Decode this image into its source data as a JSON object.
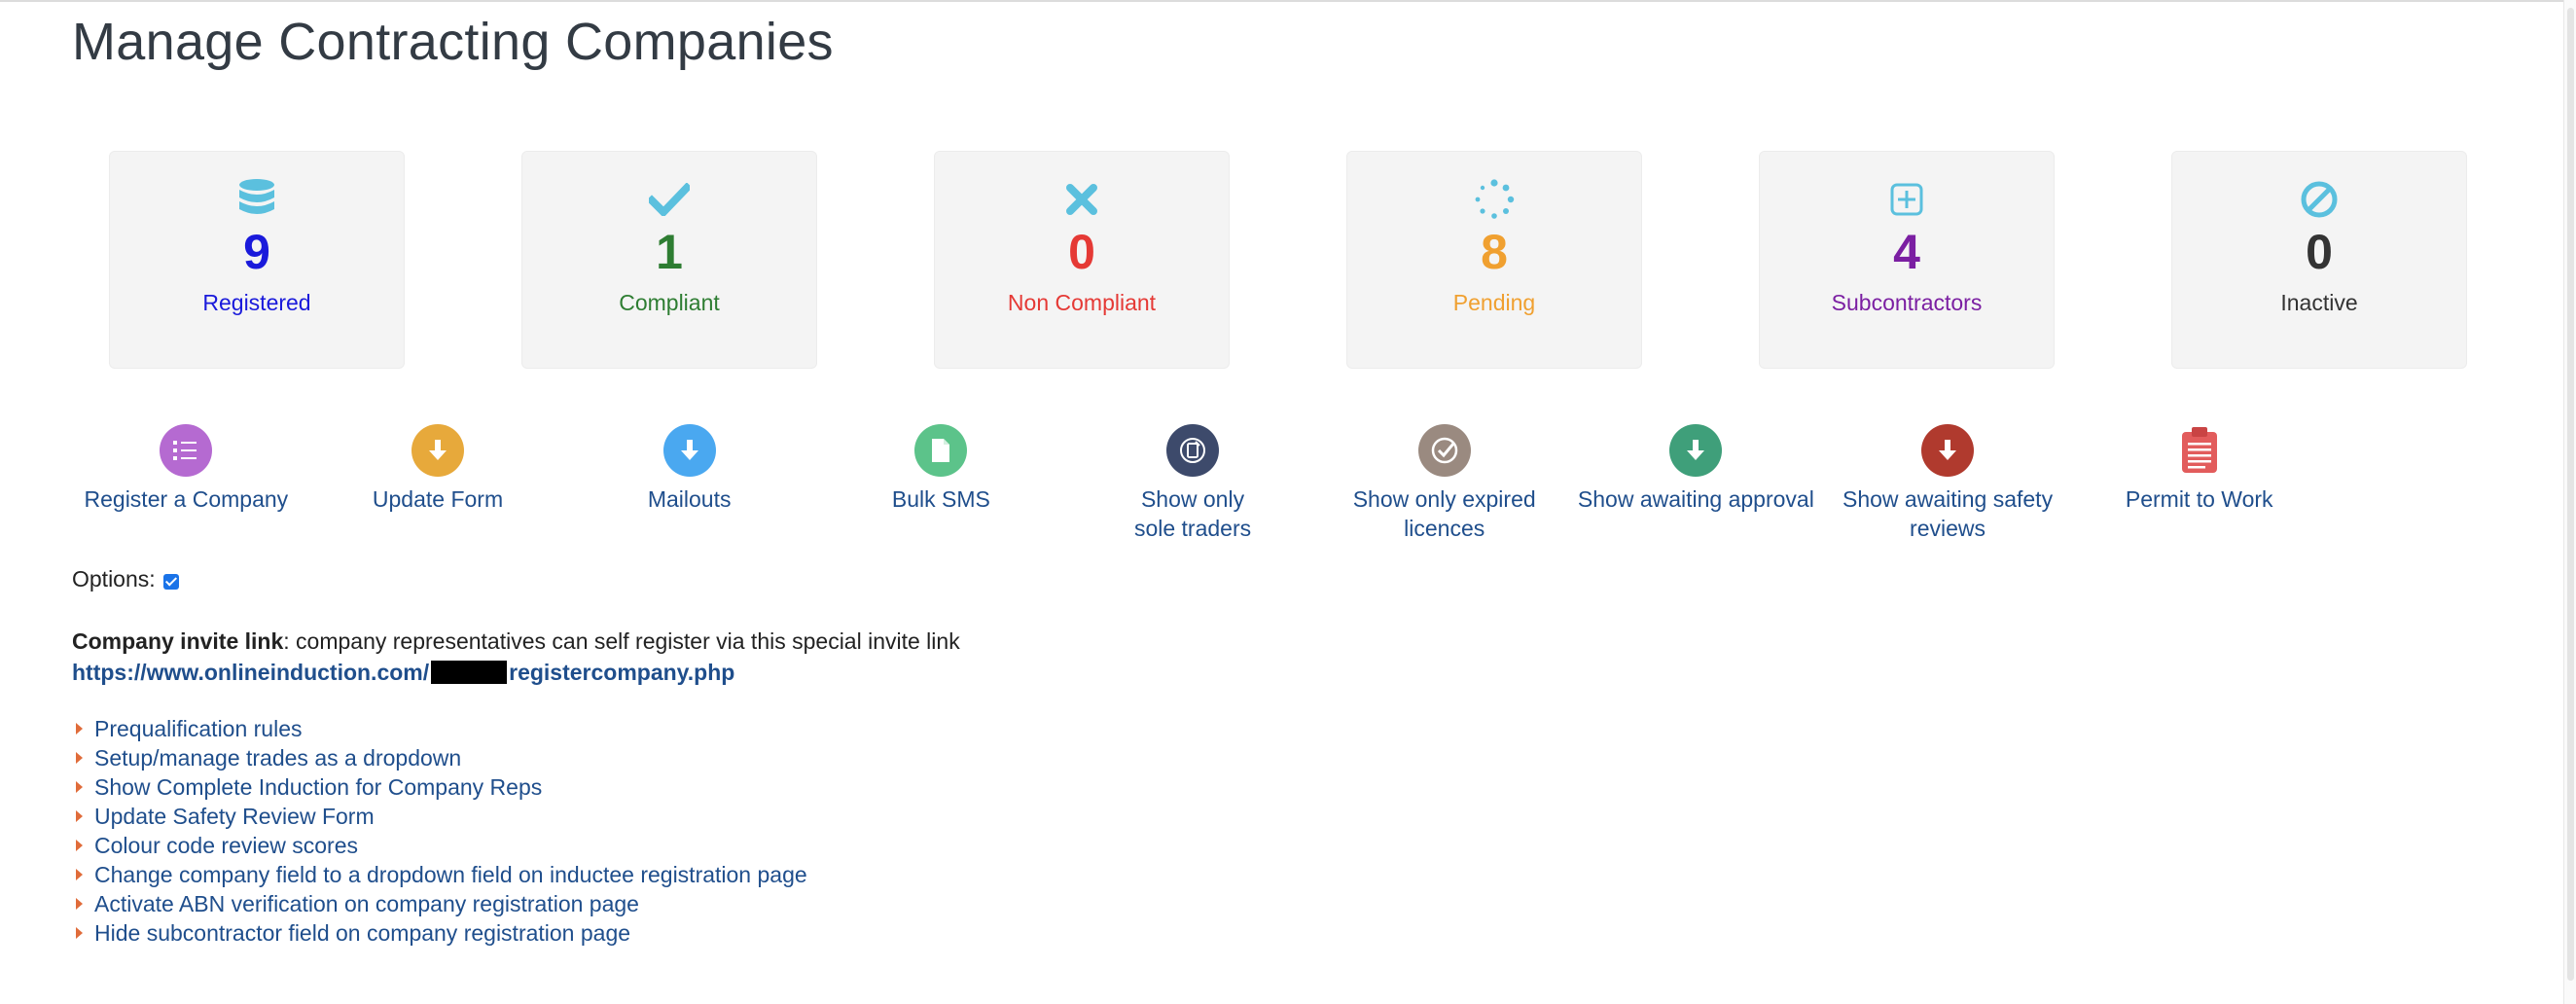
{
  "page": {
    "title": "Manage Contracting Companies"
  },
  "stats": [
    {
      "icon": "database-icon",
      "count": "9",
      "label": "Registered",
      "color": "#1a1adb",
      "icon_color": "#5bc0de"
    },
    {
      "icon": "check-icon",
      "count": "1",
      "label": "Compliant",
      "color": "#2e7d32",
      "icon_color": "#5bc0de"
    },
    {
      "icon": "times-icon",
      "count": "0",
      "label": "Non Compliant",
      "color": "#e53935",
      "icon_color": "#5bc0de"
    },
    {
      "icon": "spinner-icon",
      "count": "8",
      "label": "Pending",
      "color": "#f0a030",
      "icon_color": "#5bc0de"
    },
    {
      "icon": "plus-square-icon",
      "count": "4",
      "label": "Subcontractors",
      "color": "#7b1fa2",
      "icon_color": "#5bc0de"
    },
    {
      "icon": "ban-icon",
      "count": "0",
      "label": "Inactive",
      "color": "#333333",
      "icon_color": "#5bc0de"
    }
  ],
  "actions": [
    {
      "icon": "list-icon",
      "label": "Register a Company",
      "color": "#b56ad1"
    },
    {
      "icon": "download-icon",
      "label": "Update Form",
      "color": "#e7a93b"
    },
    {
      "icon": "download-icon",
      "label": "Mailouts",
      "color": "#4aa8f0"
    },
    {
      "icon": "document-icon",
      "label": "Bulk SMS",
      "color": "#5cc38a"
    },
    {
      "icon": "mobile-icon",
      "label": "Show only\nsole traders",
      "color": "#3d4a6b"
    },
    {
      "icon": "check-circle-icon",
      "label": "Show only expired\nlicences",
      "color": "#9a8a80"
    },
    {
      "icon": "download-icon",
      "label": "Show awaiting approval",
      "color": "#3f9f7a"
    },
    {
      "icon": "download-icon",
      "label": "Show awaiting safety\nreviews",
      "color": "#b03a2e"
    },
    {
      "icon": "clipboard-icon",
      "label": "Permit to Work",
      "color": "#e25c5c"
    }
  ],
  "options": {
    "label": "Options:",
    "checked": true
  },
  "invite": {
    "label": "Company invite link",
    "text": ": company representatives can self register via this special invite link",
    "url_prefix": "https://www.onlineinduction.com/",
    "url_suffix": "registercompany.php"
  },
  "links": [
    "Prequalification rules",
    "Setup/manage trades as a dropdown",
    "Show Complete Induction for Company Reps",
    "Update Safety Review Form",
    "Colour code review scores",
    "Change company field to a dropdown field on inductee registration page",
    "Activate ABN verification on company registration page",
    "Hide subcontractor field on company registration page"
  ]
}
